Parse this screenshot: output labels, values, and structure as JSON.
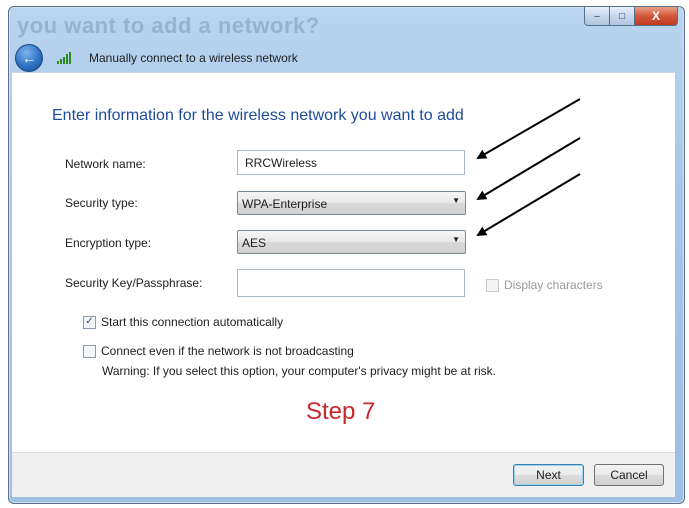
{
  "window": {
    "ghost_title": "you want to add a network?",
    "controls": {
      "minimize": "–",
      "maximize": "□",
      "close": "X"
    }
  },
  "nav": {
    "back_icon": "back-arrow-icon",
    "network_icon": "wireless-signal-icon",
    "title": "Manually connect to a wireless network"
  },
  "form": {
    "heading": "Enter information for the wireless network you want to add",
    "network_name": {
      "label": "Network name:",
      "value": "RRCWireless"
    },
    "security_type": {
      "label": "Security type:",
      "value": "WPA-Enterprise"
    },
    "encryption_type": {
      "label": "Encryption type:",
      "value": "AES"
    },
    "security_key": {
      "label": "Security Key/Passphrase:",
      "value": ""
    },
    "display_characters": {
      "label": "Display characters",
      "checked": false,
      "enabled": false
    },
    "start_auto": {
      "label": "Start this connection automatically",
      "checked": true
    },
    "connect_hidden": {
      "label": "Connect even if the network is not broadcasting",
      "checked": false
    },
    "warning": "Warning: If you select this option, your computer's privacy might be at risk."
  },
  "caption": "Step 7",
  "buttons": {
    "next": "Next",
    "cancel": "Cancel"
  },
  "colors": {
    "heading": "#1f4b9a",
    "caption": "#c8282c",
    "frame": "#a7c5e6"
  }
}
